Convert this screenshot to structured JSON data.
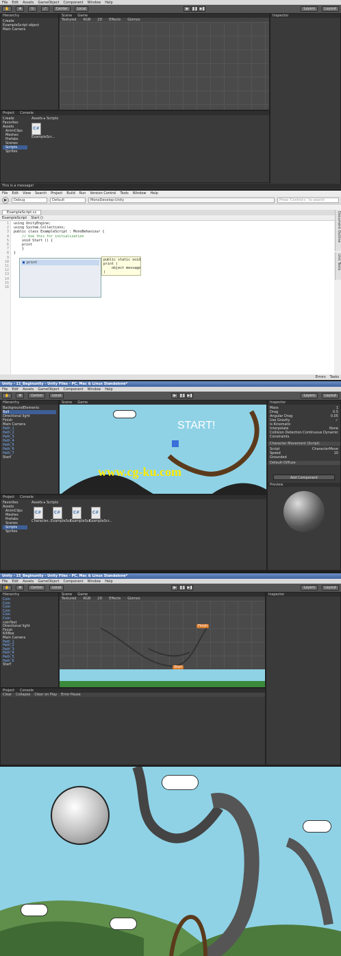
{
  "unity1": {
    "menu": [
      "File",
      "Edit",
      "Assets",
      "GameObject",
      "Component",
      "Window",
      "Help"
    ],
    "pivot": "Center",
    "space": "Local",
    "layers": "Layers",
    "layout": "Layout",
    "hierarchy_tab": "Hierarchy",
    "create": "Create",
    "hierarchy_items": [
      "ExampleScript object",
      "Main Camera"
    ],
    "scene_tab": "Scene",
    "game_tab": "Game",
    "shaded": "Textured",
    "rgb": "RGB",
    "mode_2d": "2D",
    "effects": "Effects",
    "gizmos": "Gizmos",
    "inspector_tab": "Inspector",
    "project_tab": "Project",
    "console_tab": "Console",
    "favorites": "Favorites",
    "breadcrumb": "Assets ▸ Scripts",
    "assets_tree": [
      "Assets",
      "AnimClips",
      "Meshes",
      "Prefabs",
      "Scenes",
      "Scripts",
      "Sprites"
    ],
    "file_name": "ExampleScr...",
    "status": "This is a message!"
  },
  "mono": {
    "menu": [
      "File",
      "Edit",
      "View",
      "Search",
      "Project",
      "Build",
      "Run",
      "Version Control",
      "Tools",
      "Window",
      "Help"
    ],
    "config": "Debug",
    "target": "Default",
    "app_title": "MonoDevelop-Unity",
    "search_placeholder": "Press 'Control+,' to search",
    "file_tab": "ExampleScript.cs",
    "class_crumb": "ExampleScript",
    "method_crumb": "Start ()",
    "code_lines": [
      "using UnityEngine;",
      "using System.Collections;",
      "",
      "public class ExampleScript : MonoBehaviour {",
      "",
      "    // Use this for initialization",
      "    void Start () {",
      "    print",
      "",
      "    }",
      "",
      "}"
    ],
    "line_numbers": [
      "1",
      "2",
      "3",
      "4",
      "5",
      "6",
      "7",
      "8",
      "9",
      "10",
      "11",
      "12",
      "13",
      "14",
      "15",
      "16"
    ],
    "autocomplete_item": "print",
    "tooltip": "public static void\nprint (\n    object message\n)",
    "side_tabs": [
      "Document Outline",
      "Unit Tests"
    ],
    "bottom_tabs": [
      "Errors",
      "Tasks"
    ]
  },
  "unity2": {
    "title": "Unity - 11_Beginunity - Unity Files - PC, Mac & Linux Standalone*",
    "hierarchy_items": [
      "BackgroundElements",
      "Ball",
      "Directional light",
      "Finish",
      "Main Camera",
      "Path_1",
      "Path_2",
      "Path_3",
      "Path_4",
      "Path_5",
      "Path_6",
      "Path_7",
      "Start"
    ],
    "game_text": "START!",
    "watermark": "www.cg-ku.com",
    "inspector_rows": [
      [
        "Mass",
        "1"
      ],
      [
        "Drag",
        "0.5"
      ],
      [
        "Angular Drag",
        "0.05"
      ],
      [
        "Use Gravity",
        "✓"
      ],
      [
        "Is Kinematic",
        ""
      ],
      [
        "Interpolate",
        "None"
      ],
      [
        "Collision Detection",
        "Continuous Dynamic"
      ],
      [
        "Constraints",
        ""
      ]
    ],
    "component": "Character Movement (Script)",
    "script_row": [
      "Script",
      "CharacterMove"
    ],
    "speed_row": [
      "Speed",
      "10"
    ],
    "grounded_row": [
      "Grounded",
      ""
    ],
    "material": "Default-Diffuse",
    "add_component": "Add Component",
    "preview": "Preview",
    "project_files": [
      "Character...",
      "ExampleScr...",
      "ExampleScr...",
      "ExampleScr..."
    ]
  },
  "unity3": {
    "title": "Unity - 15_Beginunity - Unity Files - PC, Mac & Linux Standalone*",
    "hierarchy_items": [
      "Coin",
      "Coin",
      "Coin",
      "Coin",
      "Coin",
      "Coin",
      "coinText",
      "Directional light",
      "Finish",
      "KillBox",
      "Main Camera",
      "Path_1",
      "Path_2",
      "Path_3",
      "Path_4",
      "Path_5",
      "Path_6",
      "Start"
    ],
    "finish_label": "Finish",
    "start_label": "Start",
    "console_buttons": [
      "Clear",
      "Collapse",
      "Clear on Play",
      "Error Pause"
    ]
  },
  "colors": {
    "sky": "#8fd2e6",
    "unity_dark": "#3c3c3c",
    "selection": "#3e5f96"
  }
}
